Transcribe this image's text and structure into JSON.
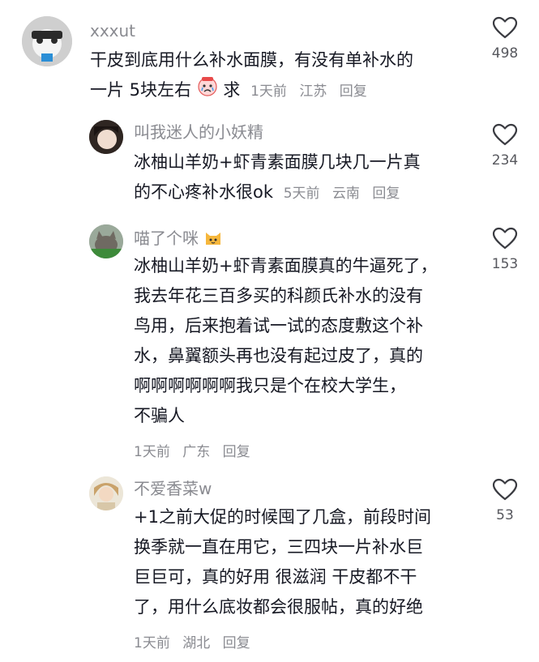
{
  "comments": [
    {
      "username": "xxxut",
      "lines": [
        "干皮到底用什么补水面膜，有没有单补水的",
        "一片 5块左右"
      ],
      "trailing_text": "求",
      "time": "1天前",
      "location": "江苏",
      "reply_label": "回复",
      "likes": "498",
      "avatar_icon": "panda-avatar",
      "emoji_icon": "crying-face-emoji"
    },
    {
      "username": "叫我迷人的小妖精",
      "lines": [
        "冰柚山羊奶+虾青素面膜几块几一片真",
        "的不心疼补水很ok"
      ],
      "time": "5天前",
      "location": "云南",
      "reply_label": "回复",
      "likes": "234",
      "avatar_icon": "person-avatar"
    },
    {
      "username": "喵了个咪",
      "name_emoji": "cat-face-emoji",
      "lines": [
        "冰柚山羊奶+虾青素面膜真的牛逼死了，",
        "我去年花三百多买的科颜氏补水的没有",
        "鸟用，后来抱着试一试的态度敷这个补",
        "水，鼻翼额头再也没有起过皮了，真的",
        "啊啊啊啊啊啊我只是个在校大学生，",
        "不骗人"
      ],
      "time": "1天前",
      "location": "广东",
      "reply_label": "回复",
      "likes": "153",
      "avatar_icon": "cat-avatar"
    },
    {
      "username": "不爱香菜w",
      "lines": [
        "+1之前大促的时候囤了几盒，前段时间",
        "换季就一直在用它，三四块一片补水巨",
        "巨巨可，真的好用 很滋润 干皮都不干",
        "了，用什么底妆都会很服帖，真的好绝"
      ],
      "time": "1天前",
      "location": "湖北",
      "reply_label": "回复",
      "likes": "53",
      "avatar_icon": "girl-avatar"
    }
  ],
  "colors": {
    "text": "#161823",
    "meta": "#8a8b91",
    "like_count": "#57585e"
  }
}
